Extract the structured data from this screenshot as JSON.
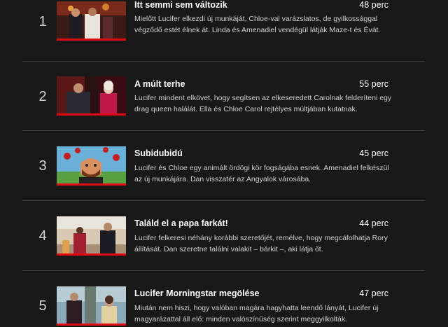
{
  "episodes": [
    {
      "index": "1",
      "title": "Itt semmi sem változik",
      "duration": "48 perc",
      "description": "Mielőtt Lucifer elkezdi új munkáját, Chloe-val varázslatos, de gyilkossággal végződő estét élnek át. Linda és Amenadiel vendégül látják Maze-t és Évát.",
      "progress": 1.0
    },
    {
      "index": "2",
      "title": "A múlt terhe",
      "duration": "55 perc",
      "description": "Lucifer mindent elkövet, hogy segítsen az elkeseredett Carolnak felderíteni egy drag queen halálát. Ella és Chloe Carol rejtélyes múltjában kutatnak.",
      "progress": 1.0
    },
    {
      "index": "3",
      "title": "Subidubidú",
      "duration": "45 perc",
      "description": "Lucifer és Chloe egy animált ördögi kör fogságába esnek. Amenadiel felkészül az új munkájára. Dan visszatér az Angyalok városába.",
      "progress": 1.0
    },
    {
      "index": "4",
      "title": "Találd el a papa farkát!",
      "duration": "44 perc",
      "description": "Lucifer felkeresi néhány korábbi szeretőjét, remélve, hogy megcáfolhatja Rory állítását. Dan szeretne találni valakit – bárkit –, aki látja őt.",
      "progress": 1.0
    },
    {
      "index": "5",
      "title": "Lucifer Morningstar megölése",
      "duration": "47 perc",
      "description": "Miután nem hiszi, hogy valóban magára hagyhatta leendő lányát, Lucifer új magyarázattal áll elő: minden valószínűség szerint meggyilkolták.",
      "progress": 1.0
    }
  ],
  "colors": {
    "background": "#181818",
    "divider": "#404040",
    "progress": "#e50914",
    "description": "#d2d2d2"
  }
}
